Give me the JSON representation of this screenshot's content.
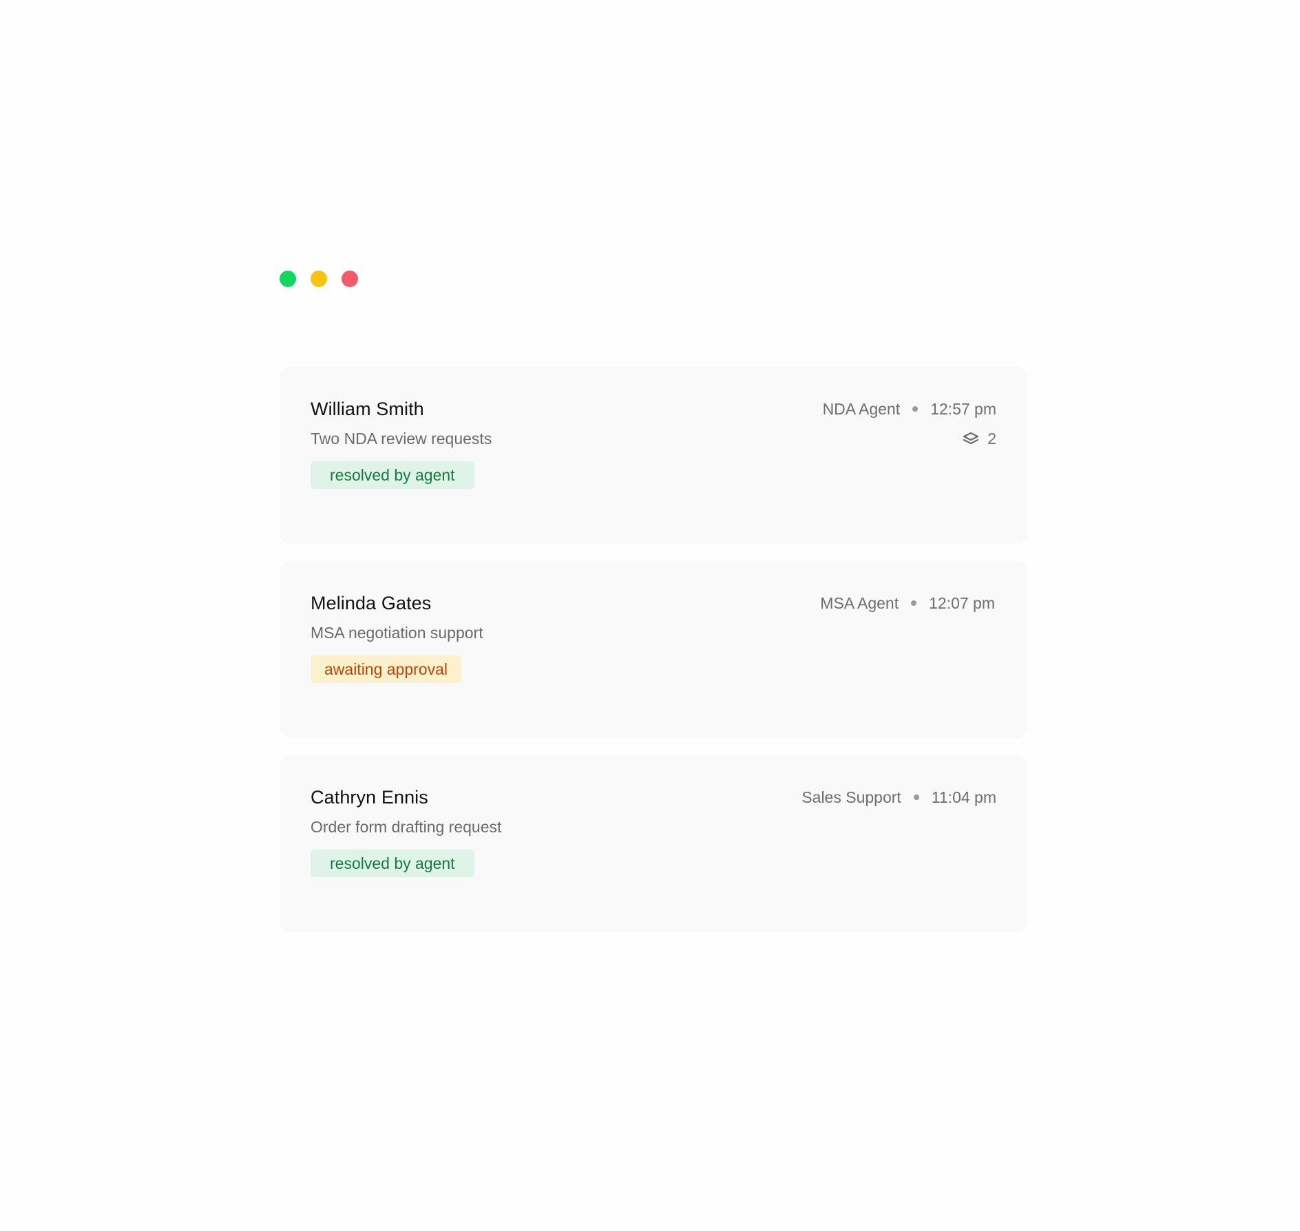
{
  "window_controls": {
    "colors": [
      "#12d660",
      "#fcc213",
      "#f45b69"
    ]
  },
  "conversations": [
    {
      "name": "William Smith",
      "agent": "NDA Agent",
      "time": "12:57 pm",
      "subtitle": "Two NDA review requests",
      "attachment_icon": "layers-icon",
      "attachment_count": "2",
      "status": "resolved by agent",
      "status_color": "#177a43",
      "status_bg": "#dff3e8"
    },
    {
      "name": "Melinda Gates",
      "agent": "MSA Agent",
      "time": "12:07 pm",
      "subtitle": "MSA negotiation support",
      "status": "awaiting approval",
      "status_color": "#b54708",
      "status_bg": "#fdf0cc"
    },
    {
      "name": "Cathryn Ennis",
      "agent": "Sales Support",
      "time": "11:04 pm",
      "subtitle": "Order form drafting request",
      "status": "resolved by agent",
      "status_color": "#177a43",
      "status_bg": "#dff3e8"
    }
  ]
}
